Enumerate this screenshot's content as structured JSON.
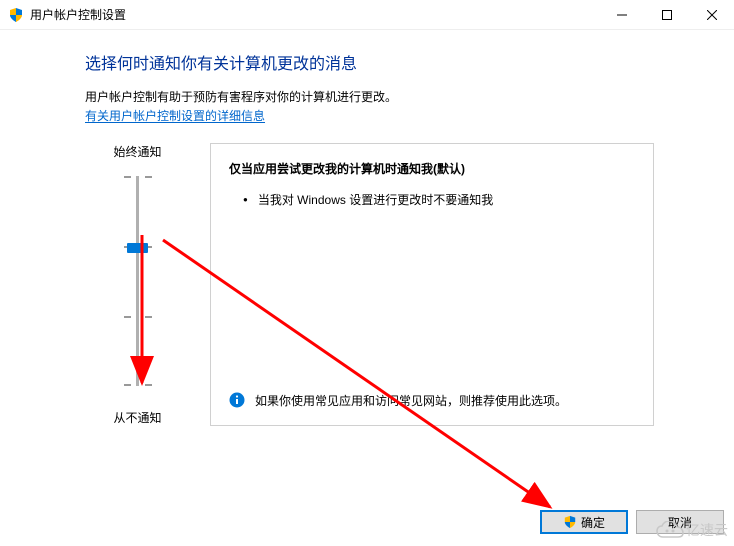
{
  "window": {
    "title": "用户帐户控制设置"
  },
  "main": {
    "heading": "选择何时通知你有关计算机更改的消息",
    "description": "用户帐户控制有助于预防有害程序对你的计算机进行更改。",
    "link_text": "有关用户帐户控制设置的详细信息"
  },
  "slider": {
    "top_label": "始终通知",
    "bottom_label": "从不通知"
  },
  "panel": {
    "title": "仅当应用尝试更改我的计算机时通知我(默认)",
    "bullet": "当我对 Windows 设置进行更改时不要通知我",
    "recommendation": "如果你使用常见应用和访问常见网站，则推荐使用此选项。"
  },
  "buttons": {
    "ok": "确定",
    "cancel": "取消"
  },
  "watermark": {
    "text": "亿速云"
  }
}
